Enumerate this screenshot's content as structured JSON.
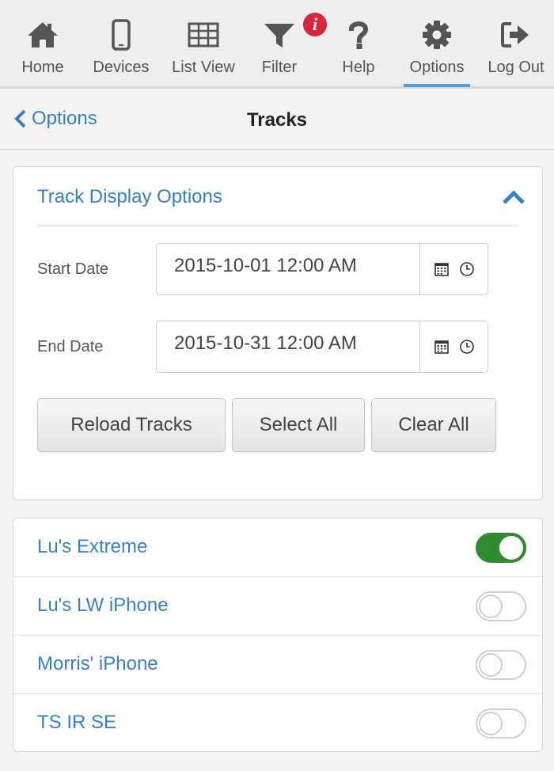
{
  "nav": {
    "items": [
      {
        "label": "Home",
        "icon": "home-icon"
      },
      {
        "label": "Devices",
        "icon": "phone-icon"
      },
      {
        "label": "List View",
        "icon": "grid-icon"
      },
      {
        "label": "Filter",
        "icon": "filter-icon",
        "badge": "i"
      },
      {
        "label": "Help",
        "icon": "question-icon"
      },
      {
        "label": "Options",
        "icon": "gear-icon",
        "active": true
      },
      {
        "label": "Log Out",
        "icon": "logout-icon"
      }
    ]
  },
  "header": {
    "back_label": "Options",
    "title": "Tracks"
  },
  "options_panel": {
    "title": "Track Display Options",
    "start_label": "Start Date",
    "start_value": "2015-10-01 12:00 AM",
    "end_label": "End Date",
    "end_value": "2015-10-31 12:00 AM",
    "reload_label": "Reload Tracks",
    "select_all_label": "Select All",
    "clear_all_label": "Clear All"
  },
  "devices": [
    {
      "name": "Lu's Extreme",
      "enabled": true
    },
    {
      "name": "Lu's LW iPhone",
      "enabled": false
    },
    {
      "name": "Morris' iPhone",
      "enabled": false
    },
    {
      "name": "TS IR SE",
      "enabled": false
    }
  ],
  "colors": {
    "link": "#3a7fc0",
    "active_underline": "#5b9bd5",
    "toggle_on": "#2e8b2e",
    "badge": "#d9263a",
    "icon": "#555555"
  }
}
